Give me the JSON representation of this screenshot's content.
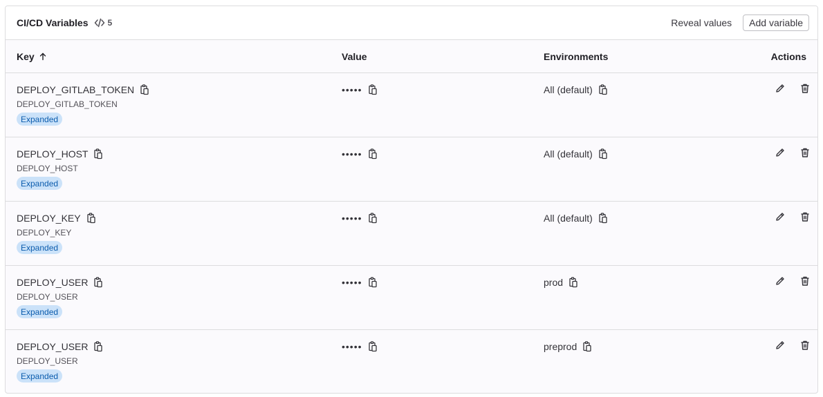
{
  "header": {
    "title": "CI/CD Variables",
    "count": "5",
    "reveal_label": "Reveal values",
    "add_label": "Add variable"
  },
  "columns": {
    "key": "Key",
    "value": "Value",
    "environments": "Environments",
    "actions": "Actions"
  },
  "rows": [
    {
      "key": "DEPLOY_GITLAB_TOKEN",
      "description": "DEPLOY_GITLAB_TOKEN",
      "badge": "Expanded",
      "value": "•••••",
      "environment": "All (default)"
    },
    {
      "key": "DEPLOY_HOST",
      "description": "DEPLOY_HOST",
      "badge": "Expanded",
      "value": "•••••",
      "environment": "All (default)"
    },
    {
      "key": "DEPLOY_KEY",
      "description": "DEPLOY_KEY",
      "badge": "Expanded",
      "value": "•••••",
      "environment": "All (default)"
    },
    {
      "key": "DEPLOY_USER",
      "description": "DEPLOY_USER",
      "badge": "Expanded",
      "value": "•••••",
      "environment": "prod"
    },
    {
      "key": "DEPLOY_USER",
      "description": "DEPLOY_USER",
      "badge": "Expanded",
      "value": "•••••",
      "environment": "preprod"
    }
  ],
  "colors": {
    "badge_bg": "#cbe2f9",
    "badge_text": "#0b5cad",
    "border": "#dcdcde"
  }
}
